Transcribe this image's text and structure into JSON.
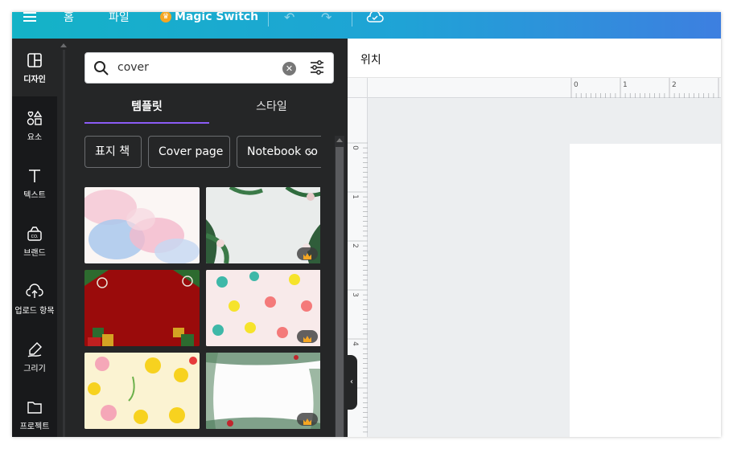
{
  "topbar": {
    "menu_icon": "hamburger-icon",
    "home": "홈",
    "file": "파일",
    "magic_switch": "Magic Switch",
    "undo_icon": "undo-icon",
    "redo_icon": "redo-icon",
    "cloud_icon": "cloud-saved-icon"
  },
  "rail": {
    "items": [
      {
        "label": "디자인",
        "icon": "design-icon"
      },
      {
        "label": "요소",
        "icon": "elements-icon"
      },
      {
        "label": "텍스트",
        "icon": "text-icon"
      },
      {
        "label": "브랜드",
        "icon": "brand-icon"
      },
      {
        "label": "업로드 항목",
        "icon": "upload-icon"
      },
      {
        "label": "그리기",
        "icon": "draw-icon"
      },
      {
        "label": "프로젝트",
        "icon": "folder-icon"
      }
    ]
  },
  "panel": {
    "search": {
      "value": "cover",
      "icon": "search-icon",
      "clear_icon": "clear-icon",
      "filter_icon": "filter-icon"
    },
    "tabs": [
      {
        "label": "템플릿"
      },
      {
        "label": "스타일"
      }
    ],
    "chips": [
      {
        "label": "표지 책"
      },
      {
        "label": "Cover page"
      },
      {
        "label": "Notebook co"
      }
    ],
    "thumbnails": [
      {
        "name": "pastel-watercolor",
        "premium": false
      },
      {
        "name": "tropical-leaves",
        "premium": true
      },
      {
        "name": "red-christmas",
        "premium": false
      },
      {
        "name": "rubber-duck-pattern",
        "premium": true
      },
      {
        "name": "yellow-flowers",
        "premium": false
      },
      {
        "name": "winter-greenery",
        "premium": true
      }
    ]
  },
  "main": {
    "position_label": "위치",
    "ruler_top": [
      "0",
      "1",
      "2"
    ],
    "ruler_left": [
      "0",
      "1",
      "2",
      "3",
      "4"
    ]
  },
  "colors": {
    "topbar_start": "#14b3c7",
    "topbar_end": "#3d7fe0",
    "panel_bg": "#252627",
    "rail_bg": "#18191b",
    "accent": "#8b5cf6"
  }
}
